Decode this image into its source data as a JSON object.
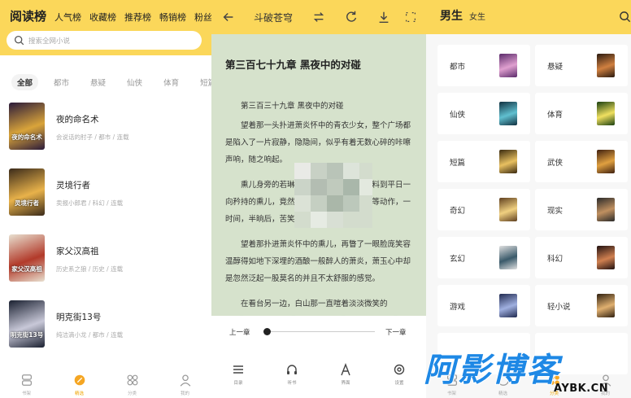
{
  "panel1": {
    "tabs": [
      "阅读榜",
      "人气榜",
      "收藏榜",
      "推荐榜",
      "畅销榜",
      "粉丝"
    ],
    "search_placeholder": "搜索全网小说",
    "categories": [
      "全部",
      "都市",
      "悬疑",
      "仙侠",
      "体育",
      "短篇"
    ],
    "books": [
      {
        "title": "夜的命名术",
        "meta": "会说话的肘子 / 都市 / 连载",
        "cover_text": "夜的命名术",
        "cover_colors": [
          "#2a1a3a",
          "#d9a43a"
        ]
      },
      {
        "title": "灵境行者",
        "meta": "卖报小郎君 / 科幻 / 连载",
        "cover_text": "灵境行者",
        "cover_colors": [
          "#3a2a1a",
          "#e8b24a"
        ]
      },
      {
        "title": "家父汉高祖",
        "meta": "历史系之狼 / 历史 / 连载",
        "cover_text": "家父汉高祖",
        "cover_colors": [
          "#e8e0d0",
          "#b23a2a"
        ]
      },
      {
        "title": "明克街13号",
        "meta": "纯洁滴小龙 / 都市 / 连载",
        "cover_text": "明克街13号",
        "cover_colors": [
          "#1a2030",
          "#c8c8d8"
        ]
      }
    ],
    "nav": [
      {
        "label": "书架",
        "icon": "bookshelf-icon",
        "active": false
      },
      {
        "label": "精选",
        "icon": "featured-icon",
        "active": true
      },
      {
        "label": "分类",
        "icon": "category-icon",
        "active": false
      },
      {
        "label": "我的",
        "icon": "profile-icon",
        "active": false
      }
    ]
  },
  "panel2": {
    "title": "斗破苍穹",
    "chapter_title": "第三百七十九章 黑夜中的对碰",
    "paragraphs": [
      "第三百三十九章 黑夜中的对碰",
      "望着那一头扑进萧炎怀中的青衣少女，整个广场都是陷入了一片寂静，隐隐间，似乎有着无数心碎的咔嚓声响，随之响起。",
      "熏儿身旁的若琳导师微微一怔，都未曾料到平日一向矜持的熏儿，竟然会在大庭广众下做出这等动作，一时间，半晌后，苦笑了一声。",
      "望着那扑进萧炎怀中的熏儿，再瞥了一眼脸庞笑容温醇得如地下深埋的酒酿一般醉人的萧炎，萧玉心中却是忽然泛起一股莫名的并且不太舒服的感觉。",
      "在看台另一边，白山那一直喧着淡淡微笑的"
    ],
    "prev_label": "上一章",
    "next_label": "下一章",
    "progress": 0.0,
    "bottom": [
      {
        "label": "目录",
        "icon": "menu-icon"
      },
      {
        "label": "听书",
        "icon": "headphones-icon"
      },
      {
        "label": "界面",
        "icon": "font-icon"
      },
      {
        "label": "设置",
        "icon": "settings-icon"
      }
    ]
  },
  "panel3": {
    "tab_active": "男生",
    "tab_other": "女生",
    "genres": [
      {
        "name": "都市",
        "cover": [
          "#5a2a6a",
          "#e0a0d0"
        ]
      },
      {
        "name": "悬疑",
        "cover": [
          "#2a1a10",
          "#d08040"
        ]
      },
      {
        "name": "仙侠",
        "cover": [
          "#103040",
          "#60c0d0"
        ]
      },
      {
        "name": "体育",
        "cover": [
          "#1a4010",
          "#f0e060"
        ]
      },
      {
        "name": "短篇",
        "cover": [
          "#3a2a10",
          "#e8c060"
        ]
      },
      {
        "name": "武侠",
        "cover": [
          "#402010",
          "#e0a040"
        ]
      },
      {
        "name": "奇幻",
        "cover": [
          "#604020",
          "#f0d080"
        ]
      },
      {
        "name": "现实",
        "cover": [
          "#2a2a2a",
          "#c09060"
        ]
      },
      {
        "name": "玄幻",
        "cover": [
          "#e0e0e0",
          "#3a5a6a"
        ]
      },
      {
        "name": "科幻",
        "cover": [
          "#201010",
          "#d08050"
        ]
      },
      {
        "name": "游戏",
        "cover": [
          "#202a50",
          "#a0b0e0"
        ]
      },
      {
        "name": "轻小说",
        "cover": [
          "#302010",
          "#e0b070"
        ]
      }
    ],
    "nav": [
      {
        "label": "书架",
        "icon": "bookshelf-icon"
      },
      {
        "label": "精选",
        "icon": "featured-icon"
      },
      {
        "label": "分类",
        "icon": "category-icon"
      },
      {
        "label": "我的",
        "icon": "profile-icon"
      }
    ]
  },
  "watermark": {
    "main": "阿影博客",
    "sub": "AYBK.CN"
  },
  "colors": {
    "accent": "#fbd75a",
    "reader_bg": "#d6e2cc",
    "active_nav": "#f0a500"
  }
}
